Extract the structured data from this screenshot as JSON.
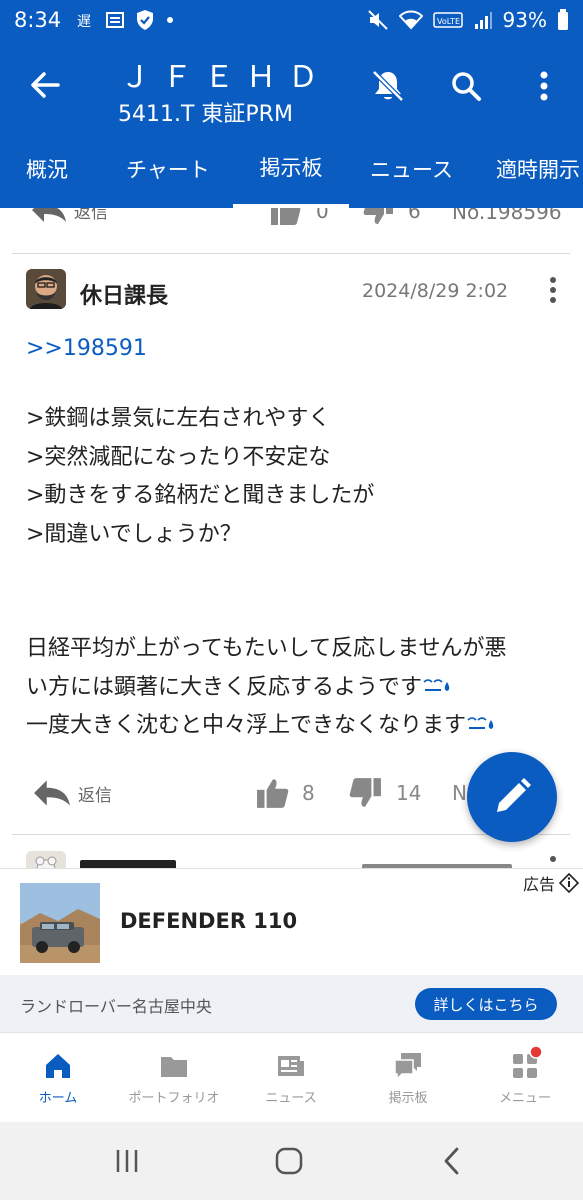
{
  "status_bar": {
    "time": "8:34",
    "battery": "93%",
    "volte": "VoLTE"
  },
  "header": {
    "stock_name": "ＪＦＥＨＤ",
    "stock_code": "5411.T 東証PRM"
  },
  "tabs": [
    {
      "label": "概況",
      "active": false
    },
    {
      "label": "チャート",
      "active": false
    },
    {
      "label": "掲示板",
      "active": true
    },
    {
      "label": "ニュース",
      "active": false
    },
    {
      "label": "適時開示",
      "active": false
    }
  ],
  "prev_post": {
    "reply_label": "返信",
    "likes": "0",
    "dislikes": "6",
    "number": "No.198596"
  },
  "post": {
    "author": "休日課長",
    "date": "2024/8/29 2:02",
    "reply_to": ">>198591",
    "quoted_lines": [
      ">鉄鋼は景気に左右されやすく",
      ">突然減配になったり不安定な",
      ">動きをする銘柄だと聞きましたが",
      ">間違いでしょうか？"
    ],
    "body_lines": [
      "日経平均が上がってもたいして反応しませんが悪",
      "い方には顕著に大きく反応するようです",
      "一度大きく沈むと中々浮上できなくなります"
    ],
    "reply_label": "返信",
    "likes": "8",
    "dislikes": "14",
    "number_partial": "N"
  },
  "ad": {
    "label": "広告",
    "title": "DEFENDER 110",
    "sponsor": "ランドローバー名古屋中央",
    "cta": "詳しくはこちら"
  },
  "bottom_nav": [
    {
      "label": "ホーム",
      "icon": "home-icon",
      "active": true
    },
    {
      "label": "ポートフォリオ",
      "icon": "folder-icon",
      "active": false
    },
    {
      "label": "ニュース",
      "icon": "newspaper-icon",
      "active": false
    },
    {
      "label": "掲示板",
      "icon": "chat-icon",
      "active": false
    },
    {
      "label": "メニュー",
      "icon": "grid-icon",
      "active": false
    }
  ],
  "colors": {
    "brand_blue": "#0b5cc1",
    "notification_dot": "#e53935"
  }
}
